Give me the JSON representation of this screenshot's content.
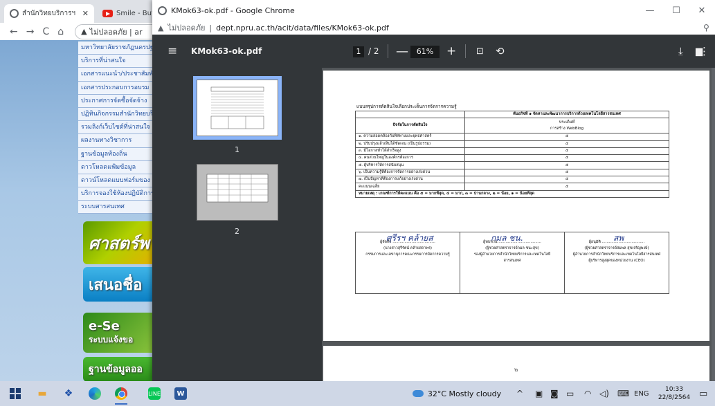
{
  "bg_browser": {
    "tab1_title": "สำนักวิทยบริการฯ",
    "tab2_title": "Smile - Butter",
    "tab_close": "✕",
    "nav_back": "←",
    "nav_forward": "→",
    "nav_reload": "C",
    "nav_home": "⌂",
    "omni_text": "ไม่ปลอดภัย | ar"
  },
  "site": {
    "menu": [
      "มหาวิทยาลัยราชภัฏนครปฐม",
      "บริการที่น่าสนใจ",
      "เอกสารแนะนำ/ประชาสัมพันธ์",
      "เอกสารประกอบการอบรม",
      "ประกาศการจัดซื้อจัดจ้าง",
      "ปฏิทินกิจกรรมสำนักวิทยบริการ",
      "รวมลิงก์เว็บไซต์ที่น่าสนใจ",
      "ผลงานทางวิชาการ",
      "ฐานข้อมูลท้องถิ่น",
      "ดาวโหลดแฟ้มข้อมูล",
      "ดาวน์โหลดแบบฟอร์มของ",
      "บริการจองใช้ห้องปฏิบัติการ",
      "ระบบสารสนเทศ"
    ],
    "banner1": "ศาสตร์พ",
    "banner2": "เสนอชื่อ",
    "banner3": "e-Se",
    "banner3b": "ระบบแจ้งขอ",
    "banner4": "ฐานข้อมูลออ"
  },
  "popup": {
    "window_title": "KMok63-ok.pdf - Google Chrome",
    "min": "—",
    "max": "☐",
    "close": "✕",
    "security": "ไม่ปลอดภัย",
    "url": "dept.npru.ac.th/acit/data/files/KMok63-ok.pdf",
    "zoom_icon": "⚲"
  },
  "viewer": {
    "menu_icon": "≡",
    "title": "KMok63-ok.pdf",
    "page_current": "1",
    "page_total": "/ 2",
    "zoom_out": "—",
    "zoom": "61%",
    "zoom_in": "+",
    "fit_icon": "⊡",
    "rotate_icon": "⟲",
    "download_icon": "⤓",
    "print_icon": "▆",
    "more_icon": "⋮",
    "thumbs": [
      "1",
      "2"
    ]
  },
  "doc": {
    "heading": "แบบสรุปการตัดสินใจเลือกประเด็นการจัดการความรู้",
    "mission_header": "พันธกิจที่ ๑ จัดหาและพัฒนาการบริการด้วยเทคโนโลยีสารสนเทศ",
    "col_factor": "ปัจจัยในการตัดสินใจ",
    "col_issue": "ประเด็นที่",
    "col_issue_sub": "การสร้าง WebBlog",
    "rows": [
      {
        "factor": "๑. ความสอดคล้องกับทิศทางและยุทธศาสตร์",
        "score": "๕"
      },
      {
        "factor": "๒. ปรับปรุงแล้วเห็นได้ชัดเจน (เป็นรูปธรรม)",
        "score": "๕"
      },
      {
        "factor": "๓. มีโอกาสทำได้สำเร็จสูง",
        "score": "๕"
      },
      {
        "factor": "๔. คนส่วนใหญ่ในองค์กรต้องการ",
        "score": "๕"
      },
      {
        "factor": "๕. ผู้บริหารให้การสนับสนุน",
        "score": "๕"
      },
      {
        "factor": "๖. เป็นความรู้ที่ต้องการจัดการอย่างเร่งด่วน",
        "score": "๕"
      },
      {
        "factor": "๗. เป็นปัญหาที่ต้องการแก้อย่างเร่งด่วน",
        "score": "๕"
      }
    ],
    "avg_label": "คะแนนเฉลี่ย",
    "avg_score": "๕",
    "note": "หมายเหตุ : เกณฑ์การให้คะแนน คือ ๕ = มากที่สุด, ๔ = มาก, ๓ = ปานกลาง, ๒ = น้อย, ๑ = น้อยที่สุด",
    "sig1": {
      "role": "ผู้จัดทำ ....................................",
      "name": "(นางสาวสุรีรัตน์ คล้ายสถาพร)",
      "pos1": "กรรมการและเลขานุการคณะกรรมการจัดการความรู้",
      "pos2": "",
      "scrawl": "ศุรีรฯ คล้ายส"
    },
    "sig2": {
      "role": "ผู้ทบทวน ....................................",
      "name": "(ผู้ช่วยศาสตราจารย์กมล ชนะสุข)",
      "pos1": "รองผู้อำนวยการสำนักวิทยบริการและเทคโนโลยี",
      "pos2": "สารสนเทศ",
      "scrawl": "กมล ชน."
    },
    "sig3": {
      "role": "ผู้อนุมัติ ....................................",
      "name": "(ผู้ช่วยศาสตราจารย์สมพล สุขเจริญพงษ์)",
      "pos1": "ผู้อำนวยการสำนักวิทยบริการและเทคโนโลยีสารสนเทศ",
      "pos2": "ผู้บริหารสูงสุดของหน่วยงาน (CEO)",
      "scrawl": "สพ"
    },
    "page2_number": "๒"
  },
  "taskbar": {
    "weather": "32°C  Mostly cloudy",
    "tray_up": "^",
    "lang": "ENG",
    "time": "10:33",
    "date": "22/8/2564",
    "notify_icon": "▭",
    "line_label": "LINE",
    "word_label": "W"
  }
}
